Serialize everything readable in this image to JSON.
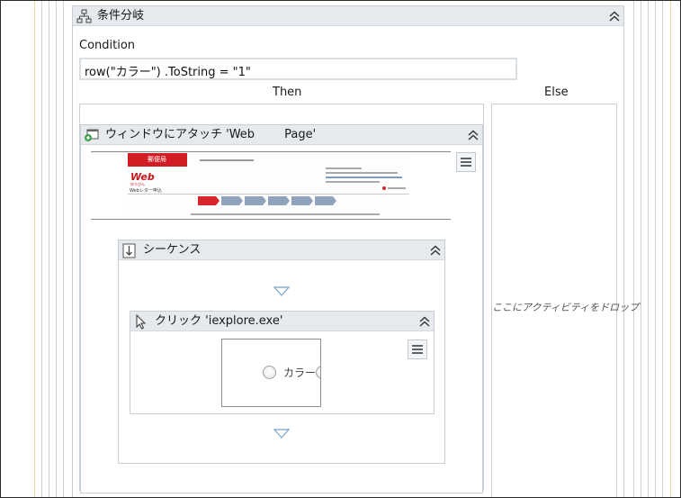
{
  "if_activity": {
    "title": "条件分岐",
    "condition_label": "Condition",
    "condition_value": "row(\"カラー\") .ToString = \"1\"",
    "then_label": "Then",
    "else_label": "Else",
    "else_drop_hint": "ここにアクティビティをドロップ"
  },
  "attach_window": {
    "title": "ウィンドウにアタッチ 'Web        Page'",
    "thumbnail": {
      "org_name": "郵便局",
      "logo_text": "Web",
      "logo_sub": "ゆうびん",
      "caption": "Webレター申込"
    }
  },
  "sequence": {
    "title": "シーケンス"
  },
  "click": {
    "title": "クリック 'iexplore.exe'",
    "preview_label": "カラー"
  },
  "colors": {
    "header_bg": "#e6e9ed",
    "border": "#c7ced6",
    "accent_red": "#d21d24"
  },
  "icons": {
    "if": "flowchart-branch-icon",
    "attach": "window-attach-icon",
    "sequence": "sequence-icon",
    "click": "mouse-pointer-icon",
    "collapse": "double-chevron-up-icon",
    "menu": "hamburger-menu-icon",
    "drop": "drop-arrow-icon"
  }
}
